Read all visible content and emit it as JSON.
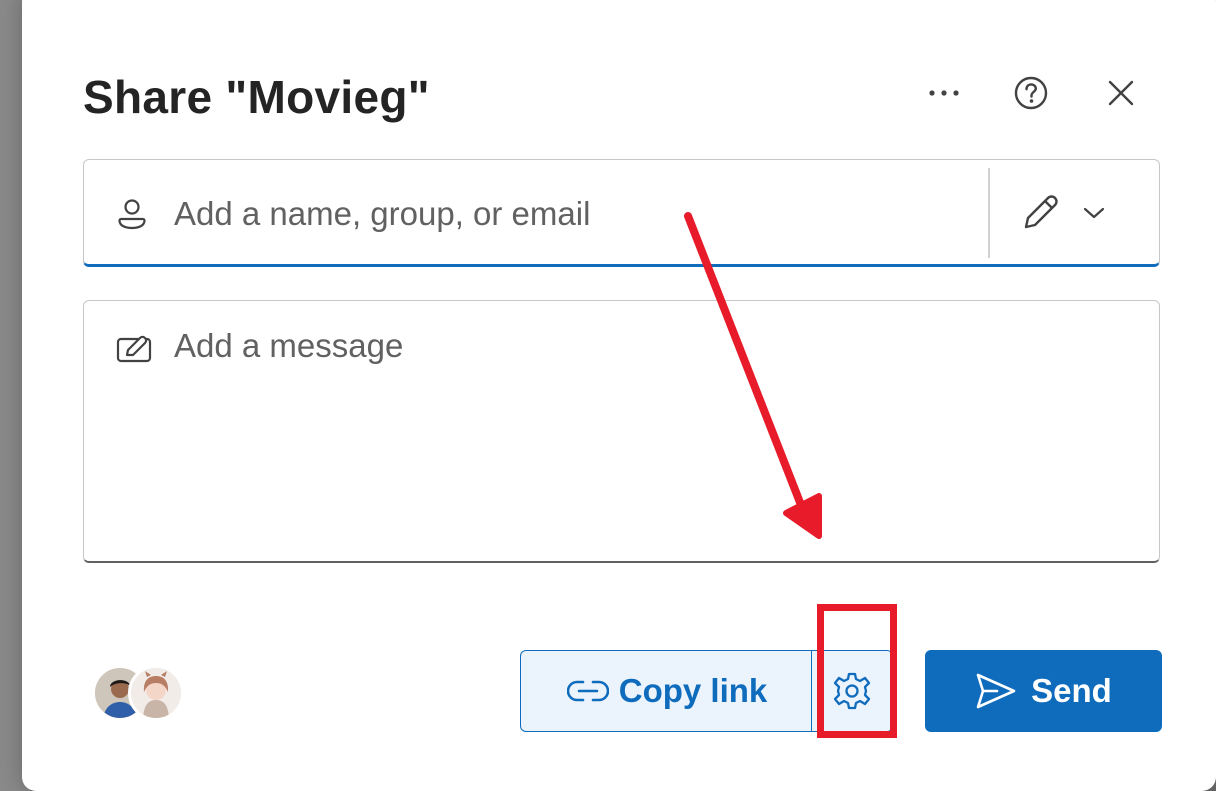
{
  "dialog": {
    "title": "Share \"Movieg\"",
    "header_icons": [
      "more-icon",
      "help-icon",
      "close-icon"
    ]
  },
  "people_field": {
    "placeholder": "Add a name, group, or email",
    "icons": [
      "person-icon",
      "pencil-icon",
      "chevron-down-icon"
    ]
  },
  "message_field": {
    "placeholder": "Add a message",
    "icon": "compose-icon"
  },
  "footer": {
    "copy_link_label": "Copy link",
    "send_label": "Send",
    "icons": [
      "link-icon",
      "gear-icon",
      "send-icon"
    ]
  },
  "colors": {
    "accent": "#0f6cbd",
    "accent_light": "#ebf3fc",
    "annotation": "#e81b2a",
    "text": "#242424",
    "placeholder": "#616161"
  }
}
